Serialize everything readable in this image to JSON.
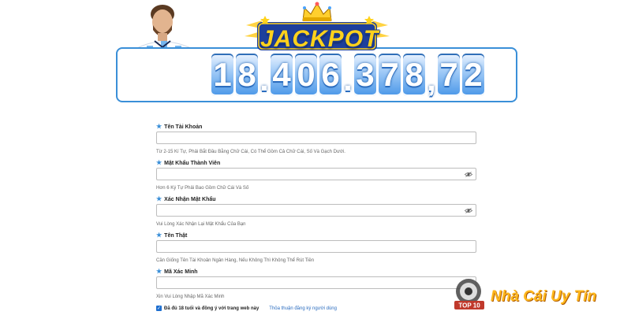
{
  "jackpot": {
    "title": "JACKPOT",
    "digits": [
      "1",
      "8",
      ".",
      "4",
      "0",
      "6",
      ".",
      "3",
      "7",
      "8",
      ",",
      "7",
      "2"
    ]
  },
  "form": {
    "fields": [
      {
        "label": "Tên Tài Khoản",
        "hint": "Từ 2-15 Kí Tự, Phải Bắt Đầu Bằng Chữ Cái, Có Thể Gồm Cả Chữ Cái, Số Và Gạch Dưới.",
        "value": "",
        "has_eye": false
      },
      {
        "label": "Mật Khẩu Thành Viên",
        "hint": "Hơn 6 Ký Tự Phải Bao Gồm Chữ Cái Và Số",
        "value": "",
        "has_eye": true
      },
      {
        "label": "Xác Nhận Mật Khẩu",
        "hint": "Vui Lòng Xác Nhận Lại Mật Khẩu Của Bạn",
        "value": "",
        "has_eye": true
      },
      {
        "label": "Tên Thật",
        "hint": "Cần Giống Tên Tài Khoản Ngân Hàng, Nếu Không Thì Không Thể Rút Tiền",
        "value": "",
        "has_eye": false
      },
      {
        "label": "Mã Xác Minh",
        "hint": "Xin Vui Lòng Nhập Mã Xác Minh",
        "value": "",
        "has_eye": false
      }
    ],
    "agree": {
      "checked": true,
      "text": "Đã đủ 18 tuổi và đồng ý với trang web này",
      "link": "Thỏa thuận đăng ký người dùng"
    }
  },
  "watermark": {
    "badge": "TOP 10",
    "text": "Nhà Cái Uy Tín"
  },
  "colors": {
    "accent": "#3a8fd8",
    "jackpot_gold": "#ffd21c",
    "watermark": "#ffb81c"
  },
  "icons": {
    "label_marker": "star-icon",
    "password_toggle": "eye-slash-icon",
    "crown": "crown-icon"
  }
}
